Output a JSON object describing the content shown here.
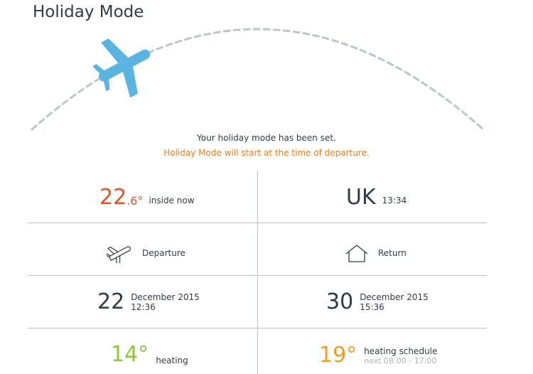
{
  "header": {
    "title": "Holiday Mode"
  },
  "icons": {
    "hero": "airplane-icon",
    "departure": "plane-departure-icon",
    "return": "house-icon"
  },
  "colors": {
    "plane": "#5ab4e0",
    "arc": "#b9c7cc",
    "notice": "#e67e22",
    "inside_temp": "#e0552b",
    "heating_temp": "#8dc63f",
    "schedule_temp": "#f39c24"
  },
  "status": {
    "line1": "Your holiday mode has been set.",
    "line2": "Holiday Mode will start at the time of departure."
  },
  "inside": {
    "whole": "22",
    "decimal": ".6°",
    "label": "inside now"
  },
  "location": {
    "country": "UK",
    "time": "13:34"
  },
  "departure": {
    "label": "Departure",
    "day": "22",
    "month_year": "December 2015",
    "time": "12:36"
  },
  "return": {
    "label": "Return",
    "day": "30",
    "month_year": "December 2015",
    "time": "15:36"
  },
  "heating": {
    "temp": "14°",
    "label": "heating"
  },
  "schedule": {
    "temp": "19°",
    "label": "heating schedule",
    "next": "next 08:00 - 17:00"
  }
}
